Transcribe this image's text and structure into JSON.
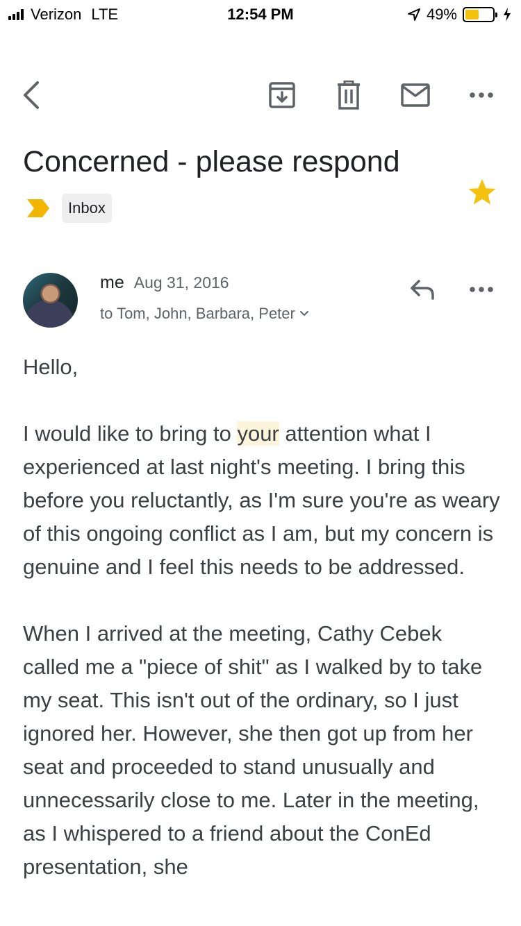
{
  "status_bar": {
    "carrier": "Verizon",
    "network": "LTE",
    "time": "12:54 PM",
    "battery": "49%",
    "battery_level": 0.49
  },
  "toolbar": {
    "back_icon": "chevron-left-icon",
    "archive_icon": "archive-icon",
    "delete_icon": "trash-icon",
    "mark_unread_icon": "mail-icon",
    "more_icon": "more-horizontal-icon"
  },
  "email": {
    "subject": "Concerned - please respond",
    "label": "Inbox",
    "starred": true,
    "sender": "me",
    "date": "Aug 31, 2016",
    "recipients": "to Tom, John, Barbara, Peter",
    "greeting": "Hello,",
    "p1_before": "I would like to bring to ",
    "p1_highlight": "your",
    "p1_after": " attention what I experienced at last night's meeting. I bring this before you reluctantly, as I'm sure you're as weary of this ongoing conflict as I am, but my concern is genuine and I feel this needs to be addressed.",
    "p2": "When I arrived at the meeting, Cathy Cebek called me a \"piece of shit\" as I walked by to take my seat. This isn't out of the ordinary, so I just ignored her. However, she then got up from her seat and proceeded to stand unusually and unnecessarily close to me. Later in the meeting, as I whispered to a friend about the ConEd presentation, she"
  },
  "colors": {
    "accent_yellow": "#f4c20d",
    "label_arrow": "#f2b600",
    "highlight": "#fdf4dc",
    "text_primary": "#202124",
    "text_secondary": "#5f6368"
  }
}
